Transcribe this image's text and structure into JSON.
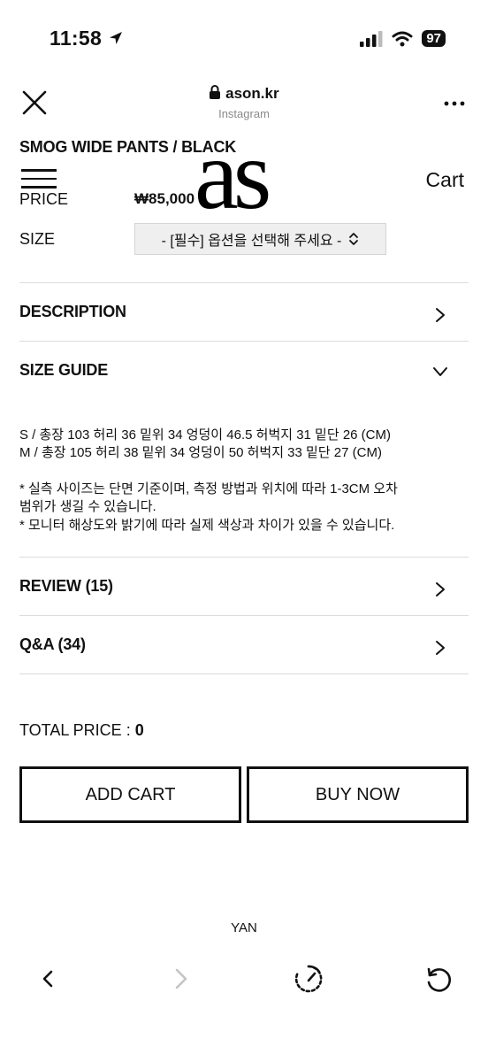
{
  "status_bar": {
    "time": "11:58",
    "battery": "97",
    "icons": [
      "location-arrow-icon",
      "signal-icon",
      "wifi-icon",
      "battery-icon"
    ]
  },
  "browser": {
    "url": "ason.kr",
    "source": "Instagram",
    "icons": [
      "close-icon",
      "lock-icon",
      "more-icon"
    ]
  },
  "site": {
    "logo": "as",
    "cart_label": "Cart"
  },
  "product": {
    "title": "SMOG WIDE PANTS / BLACK",
    "price_label": "PRICE",
    "price_value": "₩85,000",
    "size_label": "SIZE",
    "size_select_value": "- [필수] 옵션을 선택해 주세요 -"
  },
  "sections": {
    "description": "DESCRIPTION",
    "size_guide": "SIZE GUIDE",
    "review": "REVIEW (15)",
    "qna": "Q&A (34)"
  },
  "size_guide": {
    "line_s": "S / 총장 103 허리 36 밑위 34 엉덩이 46.5 허벅지 31 밑단 26 (CM)",
    "line_m": "M / 총장 105 허리 38 밑위 34 엉덩이 50 허벅지 33 밑단 27 (CM)",
    "note_1": "* 실측 사이즈는 단면 기준이며, 측정 방법과 위치에 따라 1-3CM 오차\n범위가 생길 수 있습니다.",
    "note_2": "* 모니터 해상도와 밝기에 따라 실제 색상과 차이가 있을 수 있습니다."
  },
  "order": {
    "total_label": "TOTAL PRICE : ",
    "total_value": "0",
    "add_cart": "ADD CART",
    "buy_now": "BUY NOW"
  },
  "footer": {
    "text": "YAN"
  },
  "bottom_nav": {
    "icons": [
      "back-icon",
      "forward-icon",
      "speed-icon",
      "refresh-icon"
    ]
  },
  "colors": {
    "text": "#111111",
    "divider": "#dcdcdc",
    "select_bg": "#efefef",
    "muted": "#8a8a8a",
    "disabled": "#c4c4c4"
  }
}
